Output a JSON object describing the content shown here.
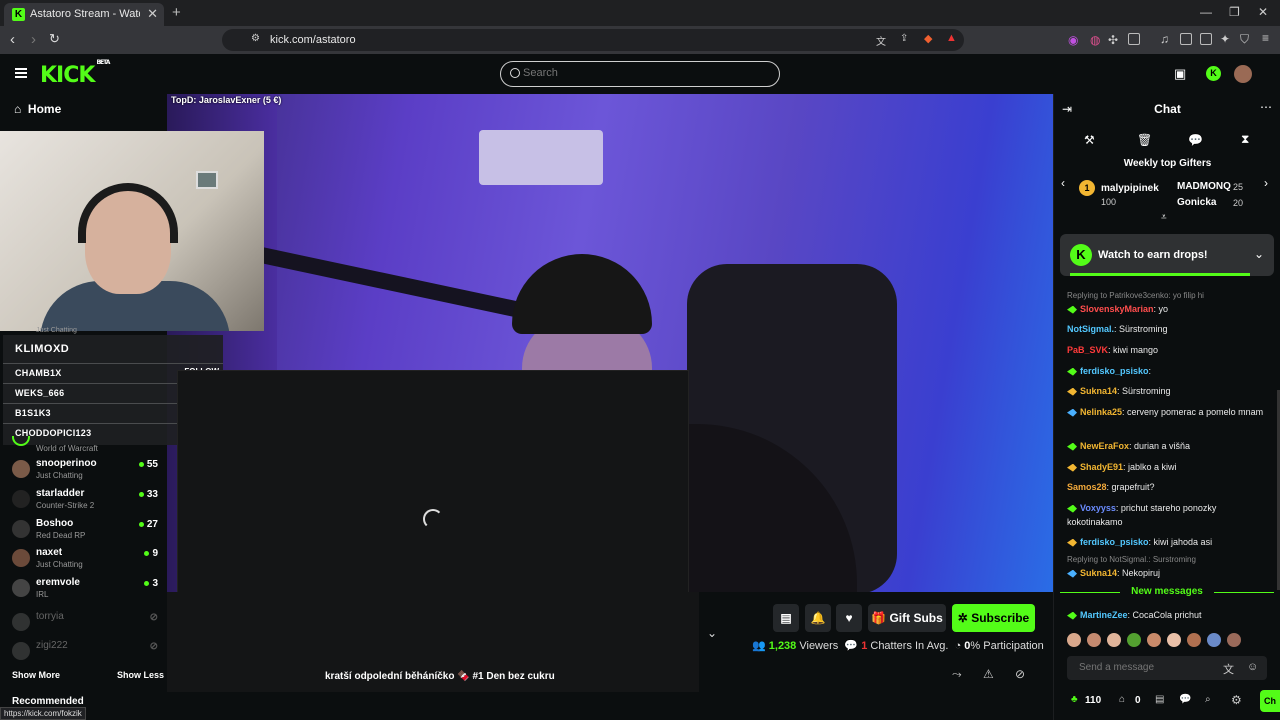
{
  "browser": {
    "tab_title": "Astatoro Stream - Watch Live",
    "url": "kick.com/astatoro",
    "status_url": "https://kick.com/fokzik"
  },
  "header": {
    "logo": "KICK",
    "logo_beta": "BETA",
    "search_placeholder": "Search"
  },
  "sidebar": {
    "home": "Home",
    "show_more": "Show More",
    "show_less": "Show Less",
    "recommended": "Recommended",
    "channels": [
      {
        "name": "snooperinoo",
        "category": "Just Chatting",
        "viewers": "55",
        "color": "#7a5a48"
      },
      {
        "name": "starladder",
        "category": "Counter-Strike 2",
        "viewers": "33",
        "color": "#222222"
      },
      {
        "name": "Boshoo",
        "category": "Red Dead RP",
        "viewers": "27",
        "color": "#333333"
      },
      {
        "name": "naxet",
        "category": "Just Chatting",
        "viewers": "9",
        "color": "#6b4a3a"
      },
      {
        "name": "eremvole",
        "category": "IRL",
        "viewers": "3",
        "color": "#444444"
      },
      {
        "name": "torryia",
        "category": "",
        "viewers": "",
        "color": "#555555"
      },
      {
        "name": "zigi222",
        "category": "",
        "viewers": "",
        "color": "#555555"
      }
    ],
    "partial_top_category": "Just Chatting",
    "partial_wow_category": "World of Warcraft"
  },
  "overlay": {
    "top_donation": "TopD: JaroslavExner (5 €)",
    "hype_title": "KLIMOXD",
    "follow_label": "FOLLOW",
    "follow_rows": [
      "CHAMB1X",
      "WEKS_666",
      "B1S1K3",
      "CHODDOPICI123"
    ]
  },
  "stream": {
    "title": "kratší odpolední běháníčko 🍫 #1 Den bez cukru",
    "gift_subs": "Gift Subs",
    "subscribe": "Subscribe",
    "viewers": "1,238",
    "viewers_label": "Viewers",
    "chatters": "1",
    "chatters_label": "Chatters In Avg.",
    "participation": "0",
    "participation_label": "% Participation"
  },
  "chat": {
    "title": "Chat",
    "weekly_title": "Weekly top Gifters",
    "gifters": [
      {
        "name": "malypipinek",
        "value": "100",
        "color": "#f2b632"
      },
      {
        "name": "MADMONQ",
        "value": "25",
        "color": "#ffffff"
      },
      {
        "name": "Gonicka",
        "value": "20",
        "color": "#f2a93b"
      }
    ],
    "drops": "Watch to earn drops!",
    "messages": [
      {
        "user": "",
        "text": "",
        "reply": "Replying to Patrikove3cenko: yo filip hi"
      },
      {
        "user": "SlovenskyMarian",
        "color": "#ff4d4d",
        "text": ": yo"
      },
      {
        "user": "NotSigmal.",
        "color": "#53c8ff",
        "text": ": Sürstroming"
      },
      {
        "user": "PaB_SVK",
        "color": "#ff3b3b",
        "text": ": kiwi mango"
      },
      {
        "user": "ferdisko_psisko",
        "color": "#53c8ff",
        "text": ":"
      },
      {
        "user": "Sukna14",
        "color": "#f2b632",
        "text": ": Sürstroming"
      },
      {
        "user": "Nelinka25",
        "color": "#f2b632",
        "text": ": cerveny pomerac a pomelo mnam"
      },
      {
        "user": "NewEraFox",
        "color": "#f2b632",
        "text": ": durian a višňa"
      },
      {
        "user": "ShadyE91",
        "color": "#f2b632",
        "text": ": jablko a kiwi"
      },
      {
        "user": "Samos28",
        "color": "#f2a93b",
        "text": ": grapefruit?"
      },
      {
        "user": "Voxyyss",
        "color": "#6b8cff",
        "text": ": prichut stareho ponozky kokotinakamo"
      },
      {
        "user": "ferdisko_psisko",
        "color": "#53c8ff",
        "text": ": kiwi jahoda asi"
      },
      {
        "user": "Sukna14",
        "color": "#f2b632",
        "text": ": Nekopiruj"
      },
      {
        "user": "MartineZee",
        "color": "#53c8ff",
        "text": ": CocaCola prichut"
      }
    ],
    "reply_notsigmal": "Replying to NotSigmal.: Surstroming",
    "new_messages": "New messages",
    "send_placeholder": "Send a message",
    "points": "110",
    "zero": "0",
    "chat_button": "Ch"
  }
}
